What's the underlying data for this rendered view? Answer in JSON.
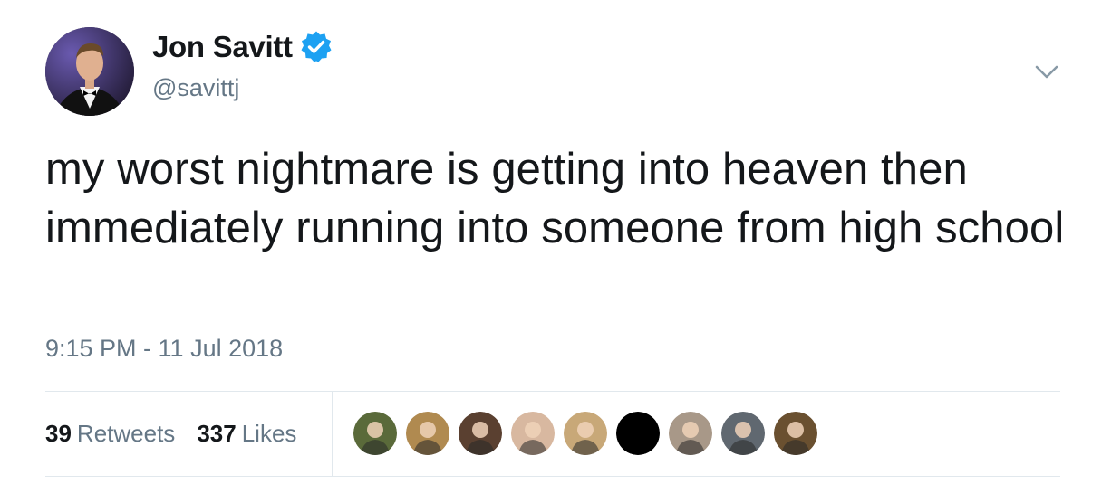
{
  "author": {
    "display_name": "Jon Savitt",
    "handle": "@savittj",
    "verified": true,
    "avatar_icon": "user-avatar"
  },
  "tweet": {
    "text": "my worst nightmare is getting into heaven then immediately running into someone from high school",
    "timestamp": "9:15 PM - 11 Jul 2018"
  },
  "stats": {
    "retweets_count": "39",
    "retweets_label": "Retweets",
    "likes_count": "337",
    "likes_label": "Likes"
  },
  "likers": [
    {
      "icon": "liker-avatar",
      "color": "#5a6a3a"
    },
    {
      "icon": "liker-avatar",
      "color": "#b08a50"
    },
    {
      "icon": "liker-avatar",
      "color": "#5a4030"
    },
    {
      "icon": "liker-avatar",
      "color": "#d8b8a0"
    },
    {
      "icon": "liker-avatar",
      "color": "#c8a878"
    },
    {
      "icon": "liker-avatar",
      "color": "#000000"
    },
    {
      "icon": "liker-avatar",
      "color": "#a89888"
    },
    {
      "icon": "liker-avatar",
      "color": "#606870"
    },
    {
      "icon": "liker-avatar",
      "color": "#6a5030"
    }
  ],
  "colors": {
    "verified": "#1da1f2",
    "secondary_text": "#657786",
    "primary_text": "#14171a",
    "divider": "#e1e8ed"
  }
}
